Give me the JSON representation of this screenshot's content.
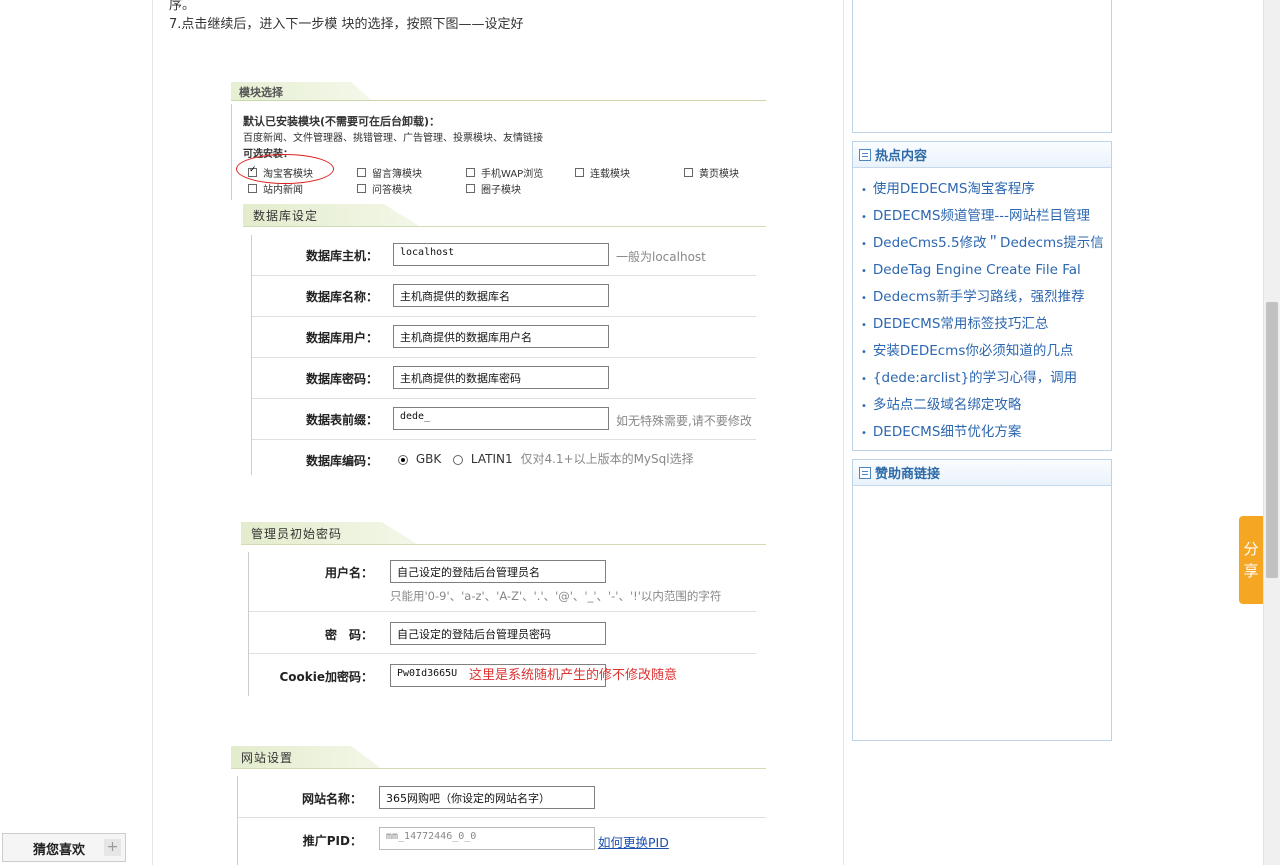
{
  "article": {
    "top_cut_text": "序。",
    "step_text": "7.点击继续后，进入下一步模 块的选择，按照下图——设定好"
  },
  "modules": {
    "header": "模块选择",
    "installed_title": "默认已安装模块(不需要可在后台卸载)：",
    "installed_list": "百度新闻、文件管理器、挑错管理、广告管理、投票模块、友情链接",
    "optional_title": "可选安装：",
    "options": [
      {
        "label": "淘宝客模块",
        "checked": true
      },
      {
        "label": "留言簿模块",
        "checked": false
      },
      {
        "label": "手机WAP浏览",
        "checked": false
      },
      {
        "label": "连载模块",
        "checked": false
      },
      {
        "label": "黄页模块",
        "checked": false
      },
      {
        "label": "站内新闻",
        "checked": false
      },
      {
        "label": "问答模块",
        "checked": false
      },
      {
        "label": "圈子模块",
        "checked": false
      }
    ]
  },
  "database": {
    "header": "数据库设定",
    "host_label": "数据库主机：",
    "host_value": "localhost",
    "host_hint": "一般为localhost",
    "name_label": "数据库名称：",
    "name_value": "主机商提供的数据库名",
    "user_label": "数据库用户：",
    "user_value": "主机商提供的数据库用户名",
    "pass_label": "数据库密码：",
    "pass_value": "主机商提供的数据库密码",
    "prefix_label": "数据表前缀：",
    "prefix_value": "dede_",
    "prefix_hint": "如无特殊需要,请不要修改",
    "charset_label": "数据库编码：",
    "charset_gbk": "GBK",
    "charset_latin": "LATIN1",
    "charset_hint": "仅对4.1+以上版本的MySql选择"
  },
  "admin": {
    "header": "管理员初始密码",
    "user_label": "用户名：",
    "user_value": "自己设定的登陆后台管理员名",
    "user_hint": "只能用'0-9'、'a-z'、'A-Z'、'.'、'@'、'_'、'-'、'!'以内范围的字符",
    "pass_label": "密　码：",
    "pass_value": "自己设定的登陆后台管理员密码",
    "cookie_label": "Cookie加密码：",
    "cookie_value": "Pw0Id3665U",
    "cookie_note": "这里是系统随机产生的修不修改随意"
  },
  "site": {
    "header": "网站设置",
    "name_label": "网站名称：",
    "name_value": "365网购吧（你设定的网站名字）",
    "pid_label": "推广PID：",
    "pid_value": "mm_14772446_0_0",
    "pid_link": "如何更换PID"
  },
  "sidebar": {
    "hot_title": "热点内容",
    "hot_items": [
      "使用DEDECMS淘宝客程序",
      "DEDECMS频道管理---网站栏目管理",
      "DedeCms5.5修改＂Dedecms提示信",
      "DedeTag Engine Create File Fal",
      "Dedecms新手学习路线，强烈推荐",
      "DEDECMS常用标签技巧汇总",
      "安装DEDEcms你必须知道的几点",
      "{dede:arclist}的学习心得，调用",
      "多站点二级域名绑定攻略",
      "DEDECMS细节优化方案"
    ],
    "sponsor_title": "赞助商链接"
  },
  "share": {
    "label": "分享"
  },
  "bottom": {
    "label": "猜您喜欢",
    "plus": "+"
  }
}
